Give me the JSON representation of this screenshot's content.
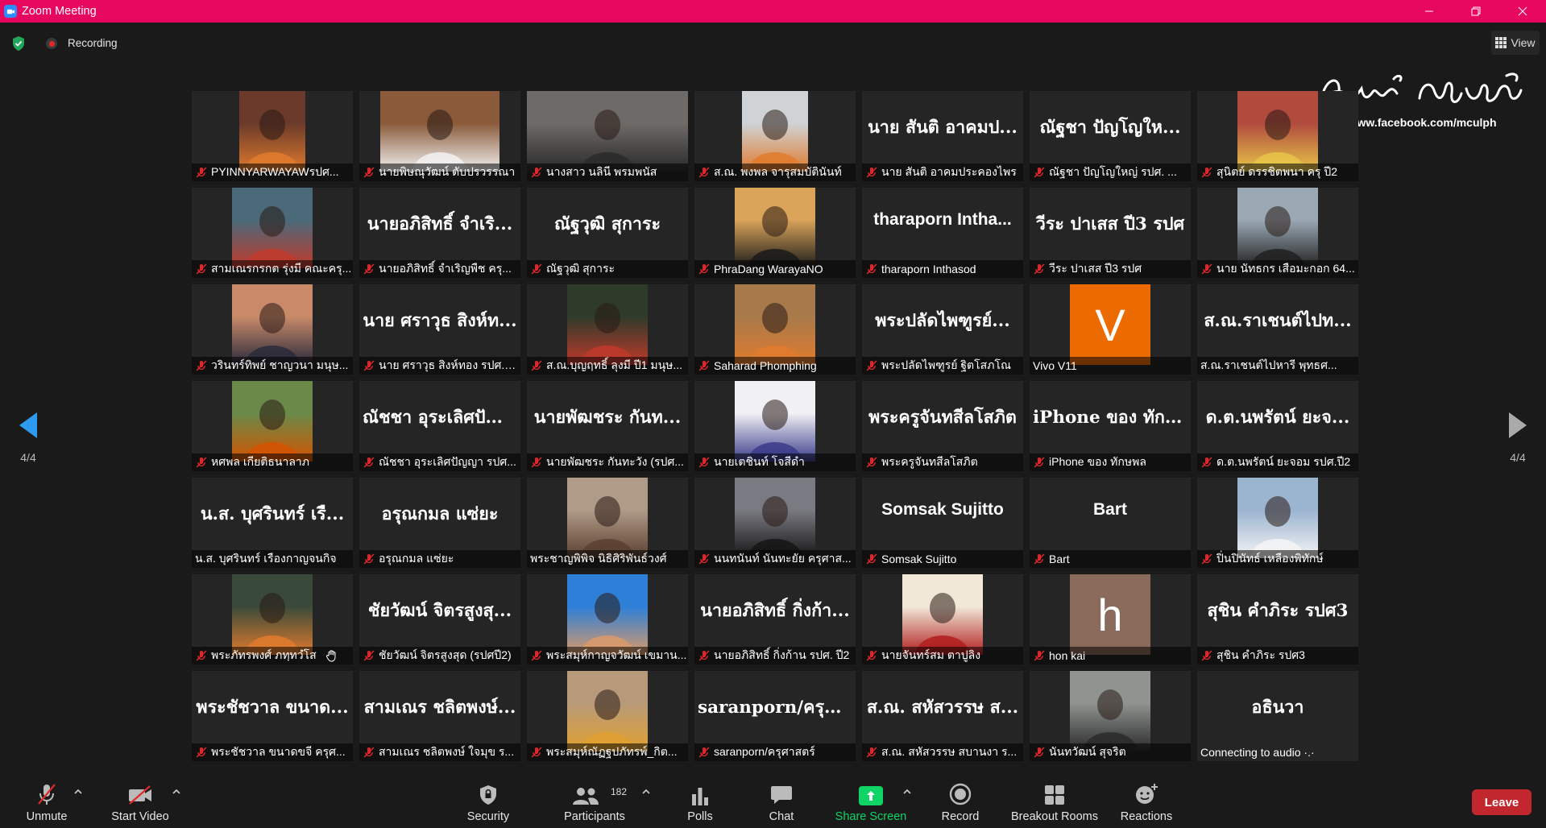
{
  "window": {
    "title": "Zoom Meeting"
  },
  "topbar": {
    "recording_label": "Recording",
    "view_label": "View"
  },
  "watermark": {
    "url": "https://www.facebook.com/mculph"
  },
  "pagination": {
    "left_page": "4/4",
    "right_page": "4/4"
  },
  "tiles": [
    {
      "label": "PYINNYARWAYAWรปศ...",
      "kind": "photo",
      "photo_bg": "#6b3a2a",
      "photo_accent": "#e07b2e",
      "photo_w": 82,
      "muted": true
    },
    {
      "label": "นายพิษณุวัฒน์ ตับปรวรรณา",
      "kind": "photo",
      "photo_bg": "#8a5a3a",
      "photo_accent": "#f2f2f2",
      "photo_w": 148,
      "muted": true
    },
    {
      "label": "นางสาว นลินี พรมพนัส",
      "kind": "photo",
      "photo_bg": "#6e6a68",
      "photo_accent": "#2a2a2a",
      "photo_w": 200,
      "muted": true
    },
    {
      "label": "ส.ณ. พงพล จารุสมบัตินันท์",
      "kind": "photo",
      "photo_bg": "#cfd3d6",
      "photo_accent": "#e07b2e",
      "photo_w": 82,
      "muted": true
    },
    {
      "label": "นาย สันติ อาคมประคองไพร",
      "kind": "name",
      "big": "นาย สันติ อาคมป...",
      "muted": true
    },
    {
      "label": "ณัฐชา ปัญโญใหญ่ รปศ. ...",
      "kind": "name",
      "big": "ณัฐชา ปัญโญให...",
      "muted": true
    },
    {
      "label": "สุนิตย์ ดรรชิตพนา ครุ ปี2",
      "kind": "photo",
      "photo_bg": "#b04b3e",
      "photo_accent": "#e8c64a",
      "photo_w": 100,
      "muted": true
    },
    {
      "label": "สามเณรกรกต รุ่งมี คณะครุ...",
      "kind": "photo",
      "photo_bg": "#4a6a7a",
      "photo_accent": "#c0392b",
      "photo_w": 100,
      "muted": true
    },
    {
      "label": "นายอภิสิทธิ์ จำเริญพืช ครุ...",
      "kind": "name",
      "big": "นายอภิสิทธิ์ จำเริ...",
      "muted": true
    },
    {
      "label": "ณัฐวุฒิ สุการะ",
      "kind": "name",
      "big": "ณัฐวุฒิ สุการะ",
      "muted": true
    },
    {
      "label": "PhraDang WarayaNO",
      "kind": "photo",
      "photo_bg": "#d9a35a",
      "photo_accent": "#1a1a1a",
      "photo_w": 100,
      "muted": true
    },
    {
      "label": "tharaporn Inthasod",
      "kind": "name",
      "big": "tharaporn Intha...",
      "latin": true,
      "muted": true
    },
    {
      "label": "วีระ ปาเสส ปี3 รปศ",
      "kind": "name",
      "big": "วีระ ปาเสส ปี3 รปศ",
      "muted": true
    },
    {
      "label": "นาย นัทธกร เสือมะกอก 64...",
      "kind": "photo",
      "photo_bg": "#9aa8b4",
      "photo_accent": "#202020",
      "photo_w": 100,
      "muted": true
    },
    {
      "label": "วรินทร์ทิพย์ ชาญวนา มนุษ...",
      "kind": "photo",
      "photo_bg": "#c98a6a",
      "photo_accent": "#2a2a3a",
      "photo_w": 100,
      "muted": true
    },
    {
      "label": "นาย ศราวุธ สิงห์ทอง รปศ.ป...",
      "kind": "name",
      "big": "นาย ศราวุธ สิงห์ท...",
      "muted": true
    },
    {
      "label": "ส.ณ.บุญฤทธิ์ ลุงมี ปี1 มนุษ...",
      "kind": "photo",
      "photo_bg": "#2f3b2a",
      "photo_accent": "#c0392b",
      "photo_w": 100,
      "muted": true
    },
    {
      "label": "Saharad Phomphing",
      "kind": "photo",
      "photo_bg": "#a87a4a",
      "photo_accent": "#e07b2e",
      "photo_w": 100,
      "muted": true
    },
    {
      "label": "พระปลัดไพฑูรย์ ฐิตโสภโณ",
      "kind": "name",
      "big": "พระปลัดไพฑูรย์...",
      "muted": true
    },
    {
      "label": "Vivo V11",
      "kind": "avatar",
      "avatar_letter": "V",
      "avatar_color": "#ec6b00",
      "muted": false
    },
    {
      "label": "ส.ณ.ราเชนต์ไปหารี พุทธศ...",
      "kind": "name",
      "big": "ส.ณ.ราเชนต์ไปท...",
      "muted": false
    },
    {
      "label": "หศพล เกียติธนาลาภ",
      "kind": "photo",
      "photo_bg": "#6a8a4a",
      "photo_accent": "#d35400",
      "photo_w": 100,
      "muted": true
    },
    {
      "label": "ณัชชา อุระเลิศปัญญา รปศ...",
      "kind": "name",
      "big": "ณัชชา อุระเลิศปัญ...",
      "muted": true
    },
    {
      "label": "นายพัฒชระ กันทะวัง (รปศ...",
      "kind": "name",
      "big": "นายพัฒชระ กันท...",
      "muted": true
    },
    {
      "label": "นายเตชินท์ โจสีดำ",
      "kind": "photo",
      "photo_bg": "#f0f0f5",
      "photo_accent": "#3b3b8a",
      "photo_w": 100,
      "muted": true
    },
    {
      "label": "พระครูจันทสีลโสภิต",
      "kind": "name",
      "big": "พระครูจันทสีลโสภิต",
      "muted": true
    },
    {
      "label": "iPhone ของ ทักษพล",
      "kind": "name",
      "big": "iPhone ของ ทักษ...",
      "muted": true
    },
    {
      "label": "ด.ต.นพรัตน์ ยะจอม รปศ.ปี2",
      "kind": "name",
      "big": "ด.ต.นพรัตน์ ยะจ...",
      "muted": true
    },
    {
      "label": "น.ส. บุศรินทร์ เรืองกาญจนกิจ",
      "kind": "name",
      "big": "น.ส. บุศรินทร์ เรื...",
      "muted": false
    },
    {
      "label": "อรุณกมล แซ่ยะ",
      "kind": "name",
      "big": "อรุณกมล แซ่ยะ",
      "muted": true
    },
    {
      "label": "พระชาญพิพิจ นิธิศิริพันธ์วงศ์",
      "kind": "photo",
      "photo_bg": "#b09a88",
      "photo_accent": "#5a4030",
      "photo_w": 100,
      "muted": false
    },
    {
      "label": "นนทนันท์ นันทะยัย ครุศาส...",
      "kind": "photo",
      "photo_bg": "#7a7a82",
      "photo_accent": "#151515",
      "photo_w": 100,
      "muted": true
    },
    {
      "label": "Somsak Sujitto",
      "kind": "name",
      "big": "Somsak Sujitto",
      "latin": true,
      "muted": true
    },
    {
      "label": "Bart",
      "kind": "name",
      "big": "Bart",
      "latin": true,
      "muted": true
    },
    {
      "label": "ปิ่นปินัทธ์ เหลืองพิทักษ์",
      "kind": "photo",
      "photo_bg": "#9bb4d0",
      "photo_accent": "#f4f4f4",
      "photo_w": 100,
      "muted": true
    },
    {
      "label": "พระภัทรพงศ์ ภทฺทวํโส",
      "kind": "photo",
      "photo_bg": "#3a4a3a",
      "photo_accent": "#e07b2e",
      "photo_w": 100,
      "muted": true,
      "hand": true
    },
    {
      "label": "ชัยวัฒน์ จิตรสูงสุด (รปศปี2)",
      "kind": "name",
      "big": "ชัยวัฒน์ จิตรสูงสุ...",
      "muted": true
    },
    {
      "label": "พระสมุห์กาญจวัฒน์ เขมาน...",
      "kind": "photo",
      "photo_bg": "#2d7fd8",
      "photo_accent": "#d99a6a",
      "photo_w": 100,
      "muted": true
    },
    {
      "label": "นายอภิสิทธิ์ กิ่งก้าน รปศ. ปี2",
      "kind": "name",
      "big": "นายอภิสิทธิ์ กิ่งก้า...",
      "muted": true
    },
    {
      "label": "นายจันทร์สม ตาปูลิง",
      "kind": "photo",
      "photo_bg": "#f2e8d8",
      "photo_accent": "#b01e1e",
      "photo_w": 100,
      "muted": true
    },
    {
      "label": "hon kai",
      "kind": "avatar",
      "avatar_letter": "h",
      "avatar_color": "#8a6a5a",
      "muted": true
    },
    {
      "label": "สุชิน คำภิระ รปศ3",
      "kind": "name",
      "big": "สุชิน คำภิระ รปศ3",
      "muted": true
    },
    {
      "label": "พระชัชวาล ขนาดขจี ครุศ...",
      "kind": "name",
      "big": "พระชัชวาล ขนาด...",
      "muted": true
    },
    {
      "label": "สามเณร ชลิตพงษ์ ใจมุข ร...",
      "kind": "name",
      "big": "สามเณร ชลิตพงษ์...",
      "muted": true
    },
    {
      "label": "พระสมุห์ณัฏฐปภัทรพ์_กิต...",
      "kind": "photo",
      "photo_bg": "#b89a7a",
      "photo_accent": "#e0a030",
      "photo_w": 100,
      "muted": true
    },
    {
      "label": "saranporn/ครุศาสตร์",
      "kind": "name",
      "big": "saranporn/ครุศา...",
      "muted": true
    },
    {
      "label": "ส.ณ. สหัสวรรษ สบานงา ร...",
      "kind": "name",
      "big": "ส.ณ. สหัสวรรษ ส...",
      "muted": true
    },
    {
      "label": "นันทวัฒน์ สุจริต",
      "kind": "photo",
      "photo_bg": "#8f9490",
      "photo_accent": "#2a2a2a",
      "photo_w": 100,
      "muted": true
    },
    {
      "label": "Connecting to audio ·.·",
      "kind": "name",
      "big": "อธินวา",
      "muted": false,
      "plain": true
    }
  ],
  "toolbar": {
    "unmute": "Unmute",
    "start_video": "Start Video",
    "security": "Security",
    "participants": "Participants",
    "participant_count": "182",
    "polls": "Polls",
    "chat": "Chat",
    "share_screen": "Share Screen",
    "record": "Record",
    "breakout_rooms": "Breakout Rooms",
    "reactions": "Reactions",
    "leave": "Leave"
  },
  "colors": {
    "titlebar": "#e8075f",
    "share": "#0ed565",
    "leave": "#c1272d",
    "muted_icon": "#e02828"
  }
}
